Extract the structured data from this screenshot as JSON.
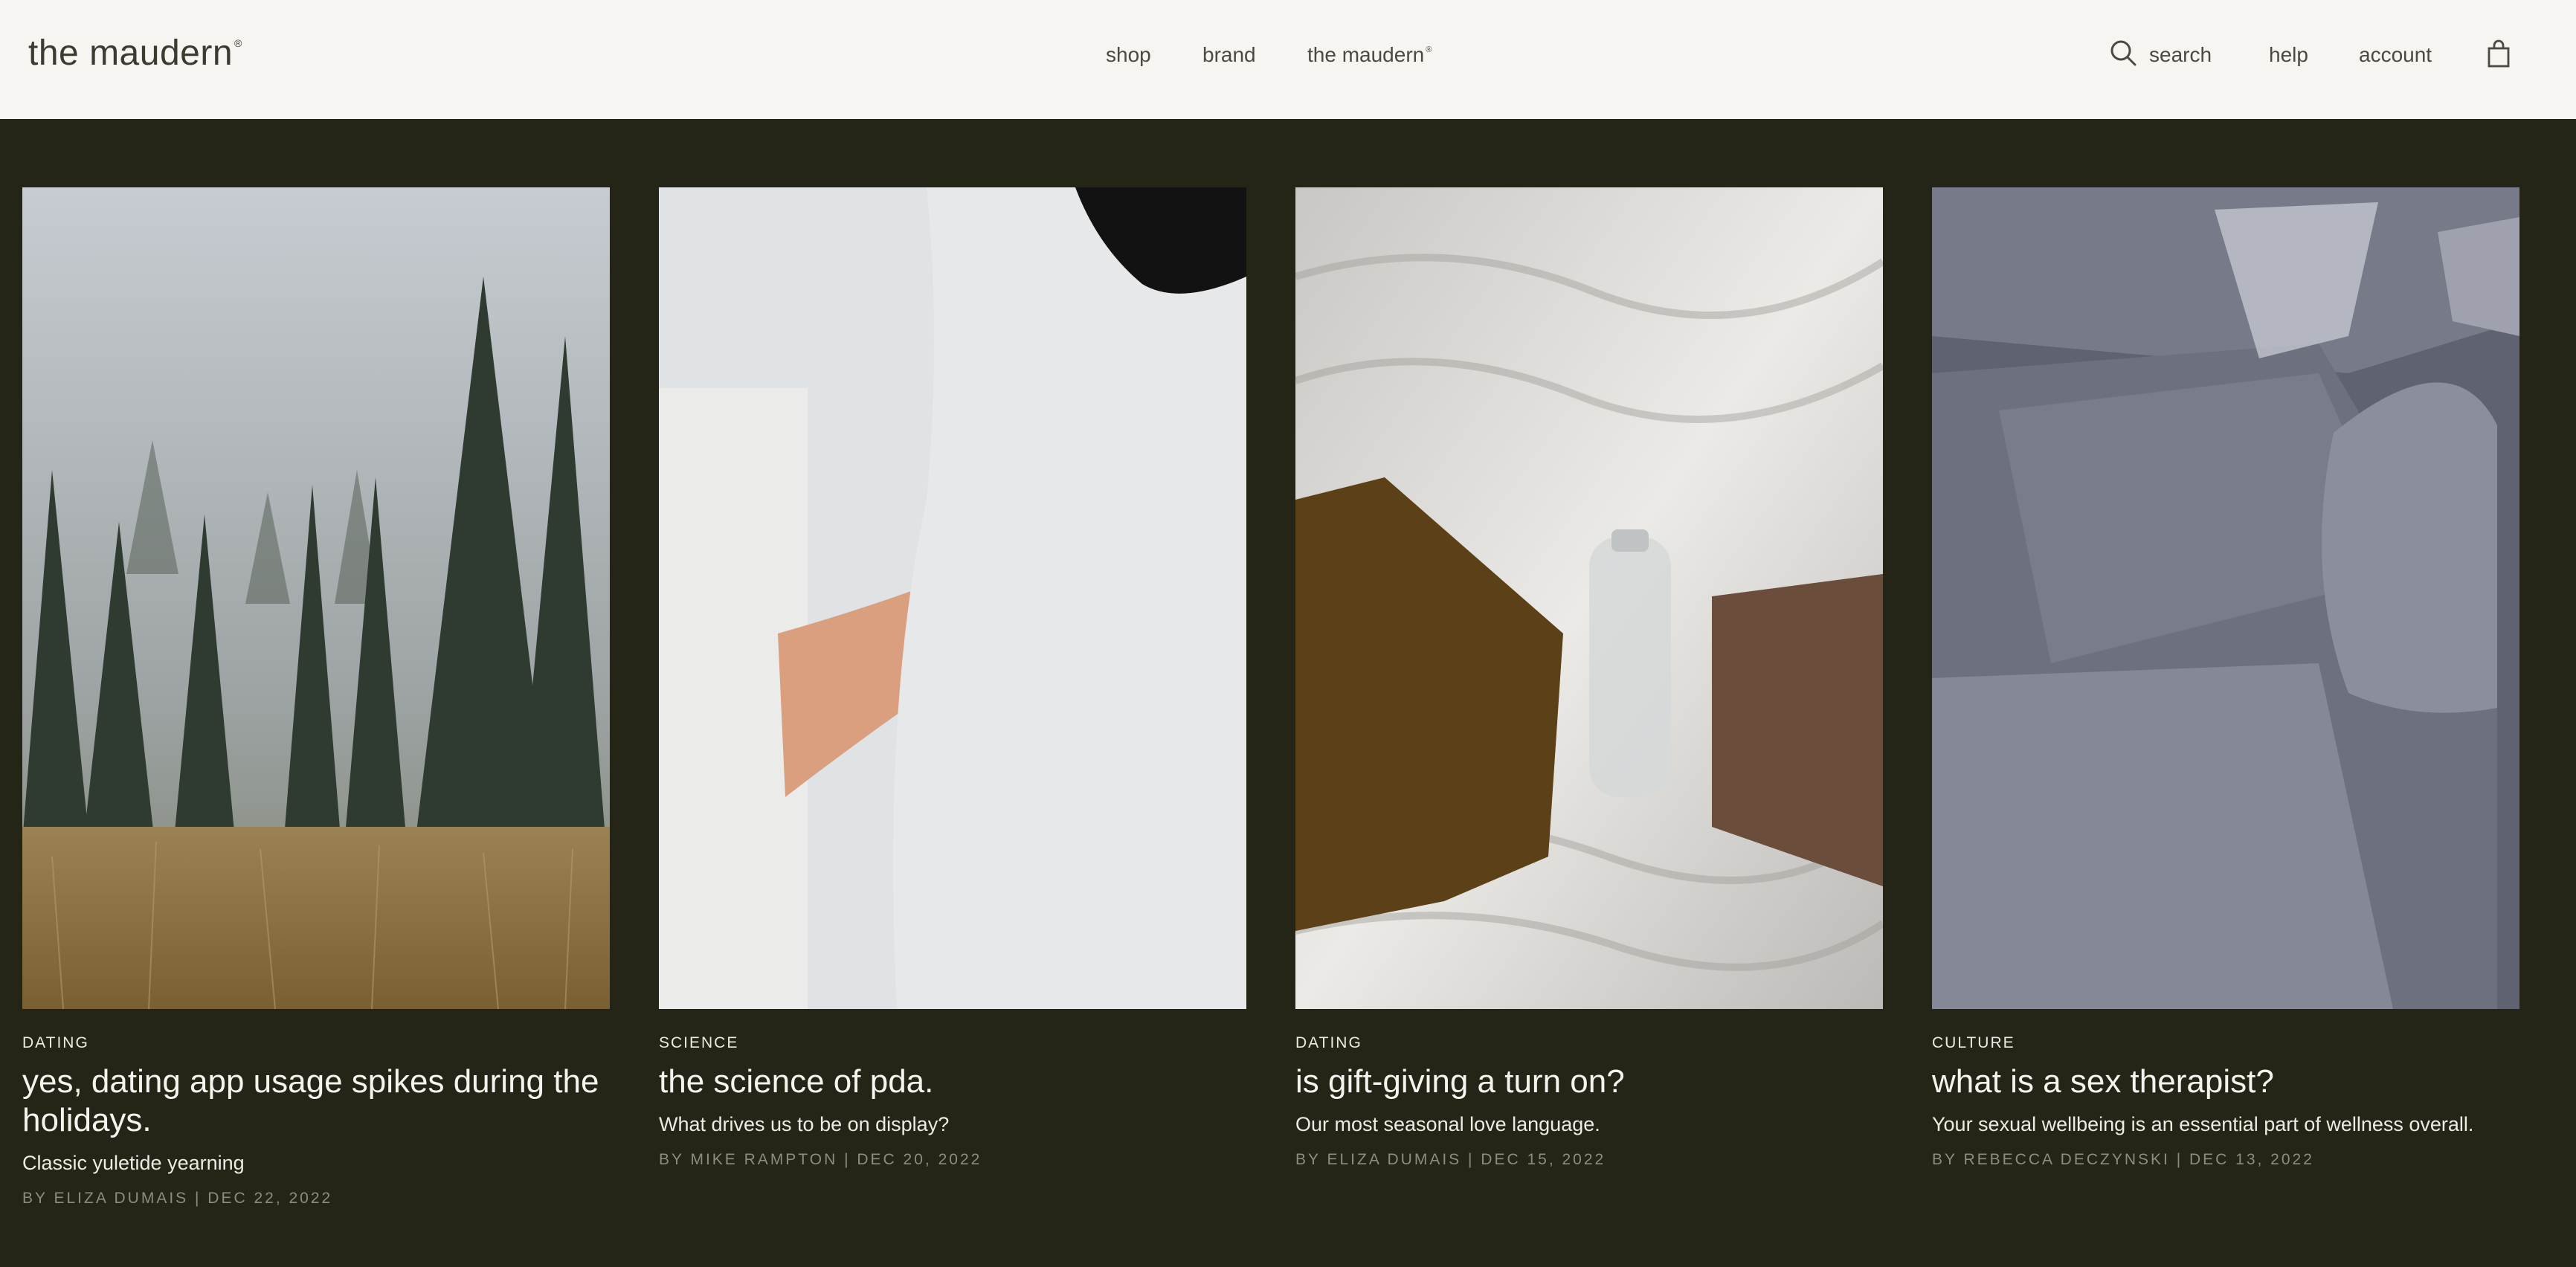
{
  "header": {
    "logo": "the maudern",
    "logo_mark": "®",
    "nav": [
      {
        "label": "shop"
      },
      {
        "label": "brand"
      },
      {
        "label": "the maudern",
        "mark": "®"
      }
    ],
    "search_label": "search",
    "help_label": "help",
    "account_label": "account"
  },
  "articles": [
    {
      "category": "DATING",
      "title": "yes, dating app usage spikes during the holidays.",
      "subtitle": "Classic yuletide yearning",
      "byline": "BY ELIZA DUMAIS | DEC 22, 2022"
    },
    {
      "category": "SCIENCE",
      "title": "the science of pda.",
      "subtitle": "What drives us to be on display?",
      "byline": "BY MIKE RAMPTON | DEC 20, 2022"
    },
    {
      "category": "DATING",
      "title": "is gift-giving a turn on?",
      "subtitle": "Our most seasonal love language.",
      "byline": "BY ELIZA DUMAIS | DEC 15, 2022"
    },
    {
      "category": "CULTURE",
      "title": "what is a sex therapist?",
      "subtitle": "Your sexual wellbeing is an essential part of wellness overall.",
      "byline": "BY REBECCA DECZYNSKI | DEC 13, 2022"
    }
  ],
  "colors": {
    "page_bg": "#242517",
    "header_bg": "#f6f5f2",
    "text_light": "#f4f3ee",
    "byline": "#8e8c7c"
  }
}
